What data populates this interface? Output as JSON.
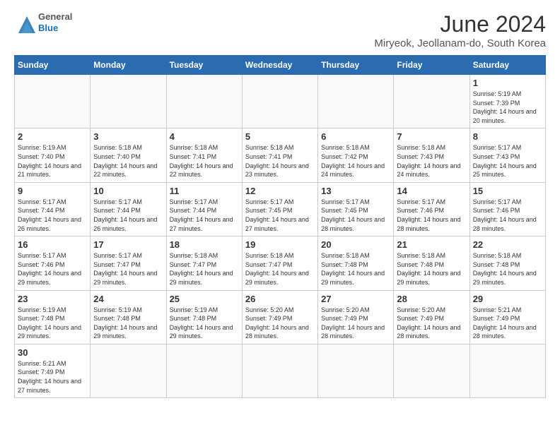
{
  "header": {
    "logo_general": "General",
    "logo_blue": "Blue",
    "main_title": "June 2024",
    "subtitle": "Miryeok, Jeollanam-do, South Korea"
  },
  "weekdays": [
    "Sunday",
    "Monday",
    "Tuesday",
    "Wednesday",
    "Thursday",
    "Friday",
    "Saturday"
  ],
  "weeks": [
    [
      {
        "day": "",
        "empty": true
      },
      {
        "day": "",
        "empty": true
      },
      {
        "day": "",
        "empty": true
      },
      {
        "day": "",
        "empty": true
      },
      {
        "day": "",
        "empty": true
      },
      {
        "day": "",
        "empty": true
      },
      {
        "day": "1",
        "sunrise": "5:19 AM",
        "sunset": "7:39 PM",
        "daylight": "14 hours and 20 minutes."
      }
    ],
    [
      {
        "day": "2",
        "sunrise": "5:19 AM",
        "sunset": "7:40 PM",
        "daylight": "14 hours and 21 minutes."
      },
      {
        "day": "3",
        "sunrise": "5:18 AM",
        "sunset": "7:40 PM",
        "daylight": "14 hours and 22 minutes."
      },
      {
        "day": "4",
        "sunrise": "5:18 AM",
        "sunset": "7:41 PM",
        "daylight": "14 hours and 22 minutes."
      },
      {
        "day": "5",
        "sunrise": "5:18 AM",
        "sunset": "7:41 PM",
        "daylight": "14 hours and 23 minutes."
      },
      {
        "day": "6",
        "sunrise": "5:18 AM",
        "sunset": "7:42 PM",
        "daylight": "14 hours and 24 minutes."
      },
      {
        "day": "7",
        "sunrise": "5:18 AM",
        "sunset": "7:43 PM",
        "daylight": "14 hours and 24 minutes."
      },
      {
        "day": "8",
        "sunrise": "5:17 AM",
        "sunset": "7:43 PM",
        "daylight": "14 hours and 25 minutes."
      }
    ],
    [
      {
        "day": "9",
        "sunrise": "5:17 AM",
        "sunset": "7:44 PM",
        "daylight": "14 hours and 26 minutes."
      },
      {
        "day": "10",
        "sunrise": "5:17 AM",
        "sunset": "7:44 PM",
        "daylight": "14 hours and 26 minutes."
      },
      {
        "day": "11",
        "sunrise": "5:17 AM",
        "sunset": "7:44 PM",
        "daylight": "14 hours and 27 minutes."
      },
      {
        "day": "12",
        "sunrise": "5:17 AM",
        "sunset": "7:45 PM",
        "daylight": "14 hours and 27 minutes."
      },
      {
        "day": "13",
        "sunrise": "5:17 AM",
        "sunset": "7:45 PM",
        "daylight": "14 hours and 28 minutes."
      },
      {
        "day": "14",
        "sunrise": "5:17 AM",
        "sunset": "7:46 PM",
        "daylight": "14 hours and 28 minutes."
      },
      {
        "day": "15",
        "sunrise": "5:17 AM",
        "sunset": "7:46 PM",
        "daylight": "14 hours and 28 minutes."
      }
    ],
    [
      {
        "day": "16",
        "sunrise": "5:17 AM",
        "sunset": "7:46 PM",
        "daylight": "14 hours and 29 minutes."
      },
      {
        "day": "17",
        "sunrise": "5:17 AM",
        "sunset": "7:47 PM",
        "daylight": "14 hours and 29 minutes."
      },
      {
        "day": "18",
        "sunrise": "5:18 AM",
        "sunset": "7:47 PM",
        "daylight": "14 hours and 29 minutes."
      },
      {
        "day": "19",
        "sunrise": "5:18 AM",
        "sunset": "7:47 PM",
        "daylight": "14 hours and 29 minutes."
      },
      {
        "day": "20",
        "sunrise": "5:18 AM",
        "sunset": "7:48 PM",
        "daylight": "14 hours and 29 minutes."
      },
      {
        "day": "21",
        "sunrise": "5:18 AM",
        "sunset": "7:48 PM",
        "daylight": "14 hours and 29 minutes."
      },
      {
        "day": "22",
        "sunrise": "5:18 AM",
        "sunset": "7:48 PM",
        "daylight": "14 hours and 29 minutes."
      }
    ],
    [
      {
        "day": "23",
        "sunrise": "5:19 AM",
        "sunset": "7:48 PM",
        "daylight": "14 hours and 29 minutes."
      },
      {
        "day": "24",
        "sunrise": "5:19 AM",
        "sunset": "7:48 PM",
        "daylight": "14 hours and 29 minutes."
      },
      {
        "day": "25",
        "sunrise": "5:19 AM",
        "sunset": "7:48 PM",
        "daylight": "14 hours and 29 minutes."
      },
      {
        "day": "26",
        "sunrise": "5:20 AM",
        "sunset": "7:49 PM",
        "daylight": "14 hours and 28 minutes."
      },
      {
        "day": "27",
        "sunrise": "5:20 AM",
        "sunset": "7:49 PM",
        "daylight": "14 hours and 28 minutes."
      },
      {
        "day": "28",
        "sunrise": "5:20 AM",
        "sunset": "7:49 PM",
        "daylight": "14 hours and 28 minutes."
      },
      {
        "day": "29",
        "sunrise": "5:21 AM",
        "sunset": "7:49 PM",
        "daylight": "14 hours and 28 minutes."
      }
    ],
    [
      {
        "day": "30",
        "sunrise": "5:21 AM",
        "sunset": "7:49 PM",
        "daylight": "14 hours and 27 minutes."
      },
      {
        "day": "",
        "empty": true
      },
      {
        "day": "",
        "empty": true
      },
      {
        "day": "",
        "empty": true
      },
      {
        "day": "",
        "empty": true
      },
      {
        "day": "",
        "empty": true
      },
      {
        "day": "",
        "empty": true
      }
    ]
  ],
  "labels": {
    "sunrise": "Sunrise:",
    "sunset": "Sunset:",
    "daylight": "Daylight:"
  }
}
